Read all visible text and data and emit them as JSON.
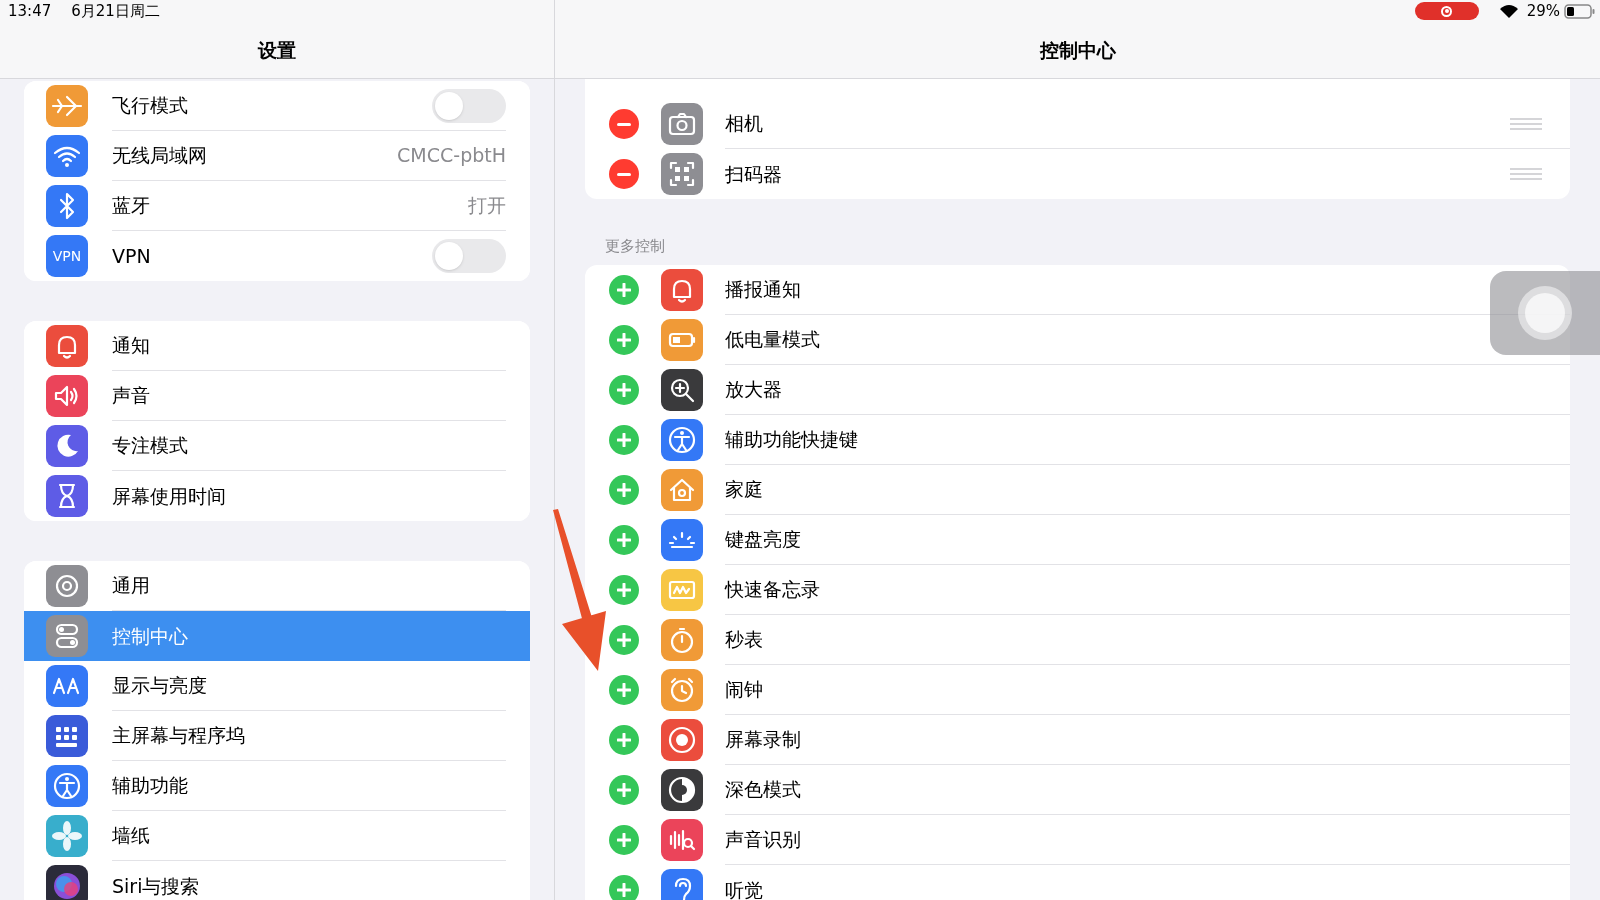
{
  "status_bar": {
    "time": "13:47",
    "date": "6月21日周二",
    "recording": true,
    "battery": "29%"
  },
  "sidebar": {
    "title": "设置",
    "groups": [
      [
        {
          "label": "飞行模式",
          "kind": "toggle",
          "on": false,
          "color": "#f09a37",
          "selected": false
        },
        {
          "label": "无线局域网",
          "kind": "value",
          "value": "CMCC-pbtH",
          "color": "#3478f6",
          "selected": false
        },
        {
          "label": "蓝牙",
          "kind": "value",
          "value": "打开",
          "color": "#3478f6",
          "selected": false
        },
        {
          "label": "VPN",
          "kind": "toggle",
          "on": false,
          "color": "#3478f6",
          "icon_text": "VPN",
          "selected": false
        }
      ],
      [
        {
          "label": "通知",
          "kind": "link",
          "color": "#eb4d3d",
          "selected": false
        },
        {
          "label": "声音",
          "kind": "link",
          "color": "#eb445a",
          "selected": false
        },
        {
          "label": "专注模式",
          "kind": "link",
          "color": "#5e5ce6",
          "selected": false
        },
        {
          "label": "屏幕使用时间",
          "kind": "link",
          "color": "#5e5ce6",
          "selected": false
        }
      ],
      [
        {
          "label": "通用",
          "kind": "link",
          "color": "#8e8e93",
          "selected": false
        },
        {
          "label": "控制中心",
          "kind": "link",
          "color": "#8e8e93",
          "selected": true
        },
        {
          "label": "显示与亮度",
          "kind": "link",
          "color": "#3478f6",
          "selected": false
        },
        {
          "label": "主屏幕与程序坞",
          "kind": "link",
          "color": "#3a5bd9",
          "selected": false
        },
        {
          "label": "辅助功能",
          "kind": "link",
          "color": "#3478f6",
          "selected": false
        },
        {
          "label": "墙纸",
          "kind": "link",
          "color": "#38aecc",
          "selected": false
        },
        {
          "label": "Siri与搜索",
          "kind": "link",
          "color": "#2b2b3a",
          "selected": false
        }
      ]
    ]
  },
  "detail": {
    "title": "控制中心",
    "included": [
      {
        "label": "相机",
        "kind": "remove",
        "color": "#8e8e93"
      },
      {
        "label": "扫码器",
        "kind": "remove",
        "color": "#8e8e93"
      }
    ],
    "more_title": "更多控制",
    "more": [
      {
        "label": "播报通知",
        "kind": "add",
        "color": "#eb4d3d"
      },
      {
        "label": "低电量模式",
        "kind": "add",
        "color": "#f09a37"
      },
      {
        "label": "放大器",
        "kind": "add",
        "color": "#3a3a3c"
      },
      {
        "label": "辅助功能快捷键",
        "kind": "add",
        "color": "#3478f6"
      },
      {
        "label": "家庭",
        "kind": "add",
        "color": "#f09a37"
      },
      {
        "label": "键盘亮度",
        "kind": "add",
        "color": "#3478f6"
      },
      {
        "label": "快速备忘录",
        "kind": "add",
        "color": "#f7c644"
      },
      {
        "label": "秒表",
        "kind": "add",
        "color": "#f09a37"
      },
      {
        "label": "闹钟",
        "kind": "add",
        "color": "#f09a37"
      },
      {
        "label": "屏幕录制",
        "kind": "add",
        "color": "#eb4d3d"
      },
      {
        "label": "深色模式",
        "kind": "add",
        "color": "#3a3a3c"
      },
      {
        "label": "声音识别",
        "kind": "add",
        "color": "#eb445a"
      },
      {
        "label": "听觉",
        "kind": "add",
        "color": "#3478f6"
      }
    ]
  },
  "assistive_touch": {
    "kind": "floating_button"
  },
  "annotation": {
    "kind": "arrow"
  }
}
